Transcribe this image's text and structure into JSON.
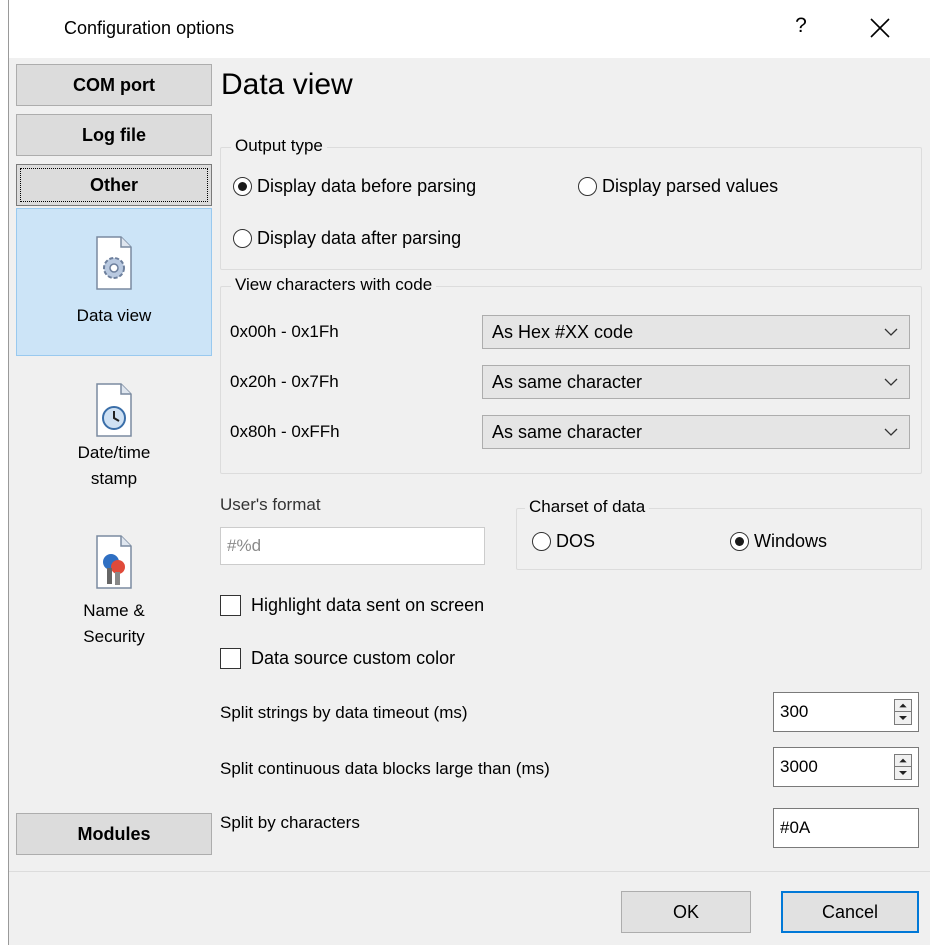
{
  "window": {
    "title": "Configuration options",
    "help_label": "?",
    "close_icon": "close-icon"
  },
  "nav": {
    "top_buttons": [
      {
        "label": "COM port",
        "active": false
      },
      {
        "label": "Log file",
        "active": false
      },
      {
        "label": "Other",
        "active": true
      }
    ],
    "items": [
      {
        "label": "Data view",
        "icon": "gear-document-icon",
        "selected": true
      },
      {
        "label": "Date/time stamp",
        "line1": "Date/time",
        "line2": "stamp",
        "icon": "clock-document-icon",
        "selected": false
      },
      {
        "label": "Name & Security",
        "line1": "Name &",
        "line2": "Security",
        "icon": "keys-document-icon",
        "selected": false
      }
    ],
    "bottom_button": {
      "label": "Modules"
    }
  },
  "main": {
    "page_title": "Data view",
    "output_type": {
      "label": "Output type",
      "options": [
        {
          "label": "Display data before parsing",
          "checked": true
        },
        {
          "label": "Display parsed values",
          "checked": false
        },
        {
          "label": "Display data after parsing",
          "checked": false
        }
      ]
    },
    "view_chars": {
      "label": "View characters with code",
      "rows": [
        {
          "range": "0x00h - 0x1Fh",
          "value": "As Hex #XX code"
        },
        {
          "range": "0x20h - 0x7Fh",
          "value": "As same character"
        },
        {
          "range": "0x80h - 0xFFh",
          "value": "As same character"
        }
      ]
    },
    "users_format": {
      "label": "User's format",
      "value": "#%d"
    },
    "charset": {
      "label": "Charset of data",
      "options": [
        {
          "label": "DOS",
          "checked": false
        },
        {
          "label": "Windows",
          "checked": true
        }
      ]
    },
    "highlight_sent": {
      "label": "Highlight data sent on screen",
      "checked": false
    },
    "custom_color": {
      "label": "Data source custom color",
      "checked": false
    },
    "split_timeout": {
      "label": "Split strings by data timeout (ms)",
      "value": "300"
    },
    "split_blocks": {
      "label": "Split continuous data blocks large than (ms)",
      "value": "3000"
    },
    "split_chars": {
      "label": "Split by characters",
      "value": "#0A"
    }
  },
  "footer": {
    "ok_label": "OK",
    "cancel_label": "Cancel"
  },
  "colors": {
    "selection_bg": "#cce4f7",
    "selection_border": "#99c9ef",
    "default_button_border": "#0078d7",
    "window_bg": "#f0f0f0"
  }
}
